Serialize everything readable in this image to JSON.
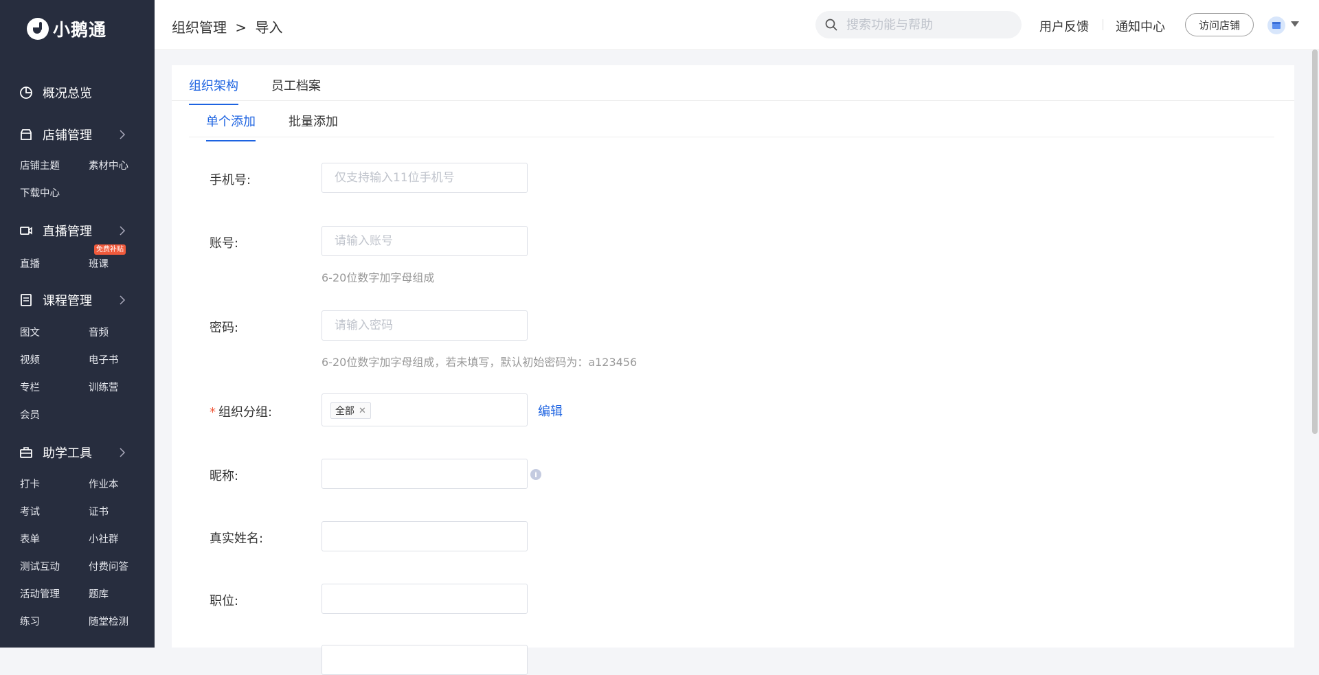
{
  "app": {
    "logo_text": "小鹅通"
  },
  "sidebar": {
    "groups": [
      {
        "title": "概况总览",
        "icon": "pie-chart-icon",
        "items": []
      },
      {
        "title": "店铺管理",
        "icon": "store-icon",
        "items": [
          "店铺主题",
          "素材中心",
          "下载中心"
        ]
      },
      {
        "title": "直播管理",
        "icon": "video-camera-icon",
        "items": [
          "直播",
          "班课"
        ],
        "badge": "免费补贴"
      },
      {
        "title": "课程管理",
        "icon": "book-icon",
        "items": [
          "图文",
          "音频",
          "视频",
          "电子书",
          "专栏",
          "训练营",
          "会员"
        ]
      },
      {
        "title": "助学工具",
        "icon": "toolbox-icon",
        "items": [
          "打卡",
          "作业本",
          "考试",
          "证书",
          "表单",
          "小社群",
          "测试互动",
          "付费问答",
          "活动管理",
          "题库",
          "练习",
          "随堂检测"
        ]
      }
    ]
  },
  "header": {
    "breadcrumb": [
      "组织管理",
      ">",
      "导入"
    ],
    "search_placeholder": "搜索功能与帮助",
    "links": [
      "用户反馈",
      "通知中心"
    ],
    "visit_store": "访问店铺"
  },
  "tabs": {
    "main": [
      "组织架构",
      "员工档案"
    ],
    "sub": [
      "单个添加",
      "批量添加"
    ]
  },
  "form": {
    "phone": {
      "label": "手机号:",
      "placeholder": "仅支持输入11位手机号",
      "value": ""
    },
    "account": {
      "label": "账号:",
      "placeholder": "请输入账号",
      "value": "",
      "hint": "6-20位数字加字母组成"
    },
    "password": {
      "label": "密码:",
      "placeholder": "请输入密码",
      "value": "",
      "hint": "6-20位数字加字母组成，若未填写，默认初始密码为：a123456"
    },
    "group": {
      "label": "组织分组:",
      "required_mark": "*",
      "tag": "全部",
      "edit": "编辑"
    },
    "nickname": {
      "label": "昵称:",
      "value": "",
      "info": "i"
    },
    "realname": {
      "label": "真实姓名:",
      "value": ""
    },
    "position": {
      "label": "职位:",
      "value": ""
    }
  },
  "colors": {
    "accent": "#1d63e1",
    "sidebar_bg": "#272d3e",
    "badge": "#f05a3c"
  }
}
